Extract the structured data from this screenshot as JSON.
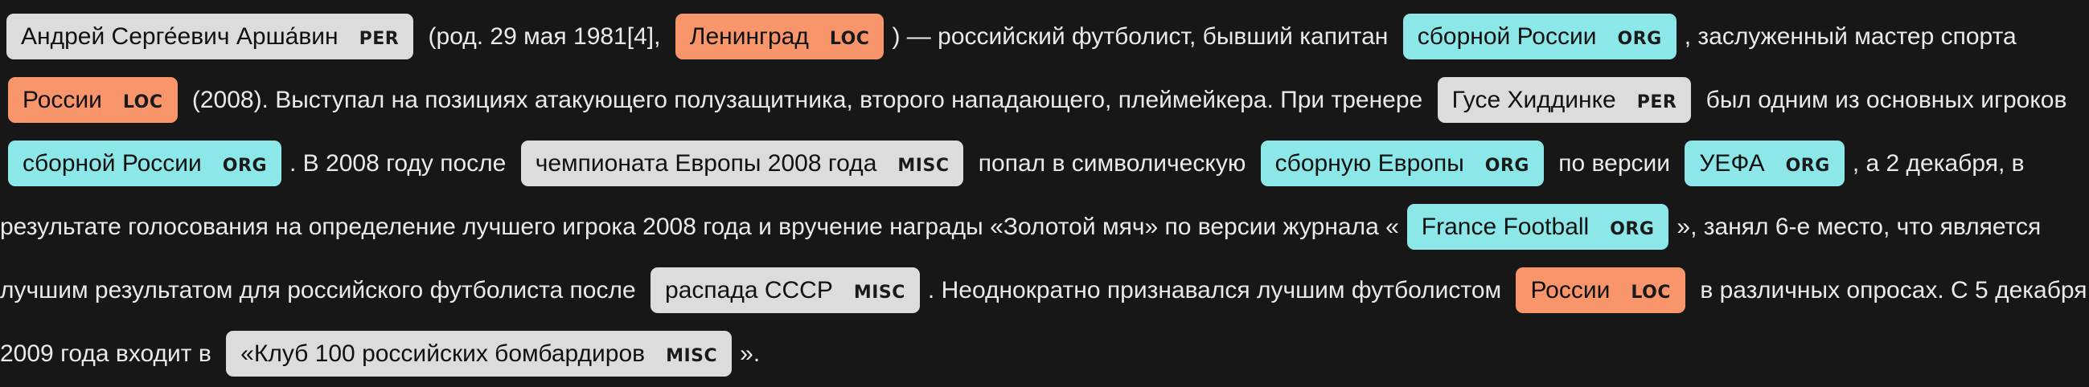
{
  "text_segments": [
    {
      "type": "entity",
      "text": "Андрей Серге́евич Арша́вин",
      "label": "PER"
    },
    {
      "type": "text",
      "text": " (род. 29 мая 1981[4], "
    },
    {
      "type": "entity",
      "text": "Ленинград",
      "label": "LOC"
    },
    {
      "type": "text",
      "text": ") — российский футболист, бывший капитан "
    },
    {
      "type": "entity",
      "text": "сборной России",
      "label": "ORG"
    },
    {
      "type": "text",
      "text": ", заслуженный мастер спорта "
    },
    {
      "type": "entity",
      "text": "России",
      "label": "LOC"
    },
    {
      "type": "text",
      "text": " (2008). Выступал на позициях атакующего полузащитника, второго нападающего, плеймейкера. При тренере "
    },
    {
      "type": "entity",
      "text": "Гусе Хиддинке",
      "label": "PER"
    },
    {
      "type": "text",
      "text": " был одним из основных игроков "
    },
    {
      "type": "entity",
      "text": "сборной России",
      "label": "ORG"
    },
    {
      "type": "text",
      "text": ". В 2008 году после "
    },
    {
      "type": "entity",
      "text": "чемпионата Европы 2008 года",
      "label": "MISC"
    },
    {
      "type": "text",
      "text": " попал в символическую "
    },
    {
      "type": "entity",
      "text": "сборную Европы",
      "label": "ORG"
    },
    {
      "type": "text",
      "text": " по версии "
    },
    {
      "type": "entity",
      "text": "УЕФА",
      "label": "ORG"
    },
    {
      "type": "text",
      "text": ", а 2 декабря, в результате голосования на определение лучшего игрока 2008 года и вручение награды «Золотой мяч» по версии журнала «"
    },
    {
      "type": "entity",
      "text": "France Football",
      "label": "ORG"
    },
    {
      "type": "text",
      "text": "», занял 6-е место, что является лучшим результатом для российского футболиста после "
    },
    {
      "type": "entity",
      "text": "распада СССР",
      "label": "MISC"
    },
    {
      "type": "text",
      "text": ". Неоднократно признавался лучшим футболистом "
    },
    {
      "type": "entity",
      "text": "России",
      "label": "LOC"
    },
    {
      "type": "text",
      "text": " в различных опросах. С 5 декабря 2009 года входит в "
    },
    {
      "type": "entity",
      "text": "«Клуб 100 российских бомбардиров",
      "label": "MISC"
    },
    {
      "type": "text",
      "text": "»."
    }
  ],
  "label_colors": {
    "PER": "#dcdcdc",
    "LOC": "#f8956b",
    "ORG": "#8ce8e8",
    "MISC": "#dcdcdc"
  }
}
